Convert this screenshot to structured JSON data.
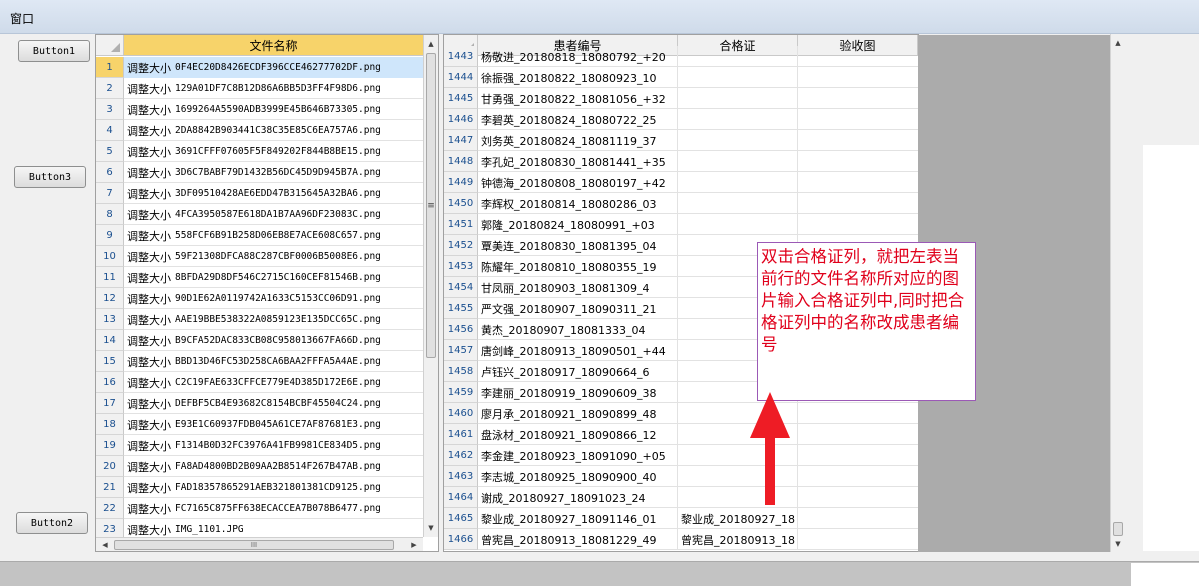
{
  "window": {
    "title": "窗口"
  },
  "buttons": {
    "button1": "Button1",
    "button3": "Button3",
    "button2": "Button2"
  },
  "left_grid": {
    "column": "文件名称",
    "rows": [
      {
        "n": "1",
        "text": "调整大小",
        "file": "0F4EC20D8426ECDF396CCE46277702DF.png"
      },
      {
        "n": "2",
        "text": "调整大小",
        "file": "129A01DF7C8B12D86A6BB5D3FF4F98D6.png"
      },
      {
        "n": "3",
        "text": "调整大小",
        "file": "1699264A5590ADB3999E45B646B73305.png"
      },
      {
        "n": "4",
        "text": "调整大小",
        "file": "2DA8842B903441C38C35E85C6EA757A6.png"
      },
      {
        "n": "5",
        "text": "调整大小",
        "file": "3691CFFF07605F5F849202F844B8BE15.png"
      },
      {
        "n": "6",
        "text": "调整大小",
        "file": "3D6C7BABF79D1432B56DC45D9D945B7A.png"
      },
      {
        "n": "7",
        "text": "调整大小",
        "file": "3DF09510428AE6EDD47B315645A32BA6.png"
      },
      {
        "n": "8",
        "text": "调整大小",
        "file": "4FCA3950587E618DA1B7AA96DF23083C.png"
      },
      {
        "n": "9",
        "text": "调整大小",
        "file": "558FCF6B91B258D06EB8E7ACE608C657.png"
      },
      {
        "n": "10",
        "text": "调整大小",
        "file": "59F21308DFCA88C287CBF0006B5008E6.png"
      },
      {
        "n": "11",
        "text": "调整大小",
        "file": "8BFDA29D8DF546C2715C160CEF81546B.png"
      },
      {
        "n": "12",
        "text": "调整大小",
        "file": "90D1E62A0119742A1633C5153CC06D91.png"
      },
      {
        "n": "13",
        "text": "调整大小",
        "file": "AAE19BBE538322A0859123E135DCC65C.png"
      },
      {
        "n": "14",
        "text": "调整大小",
        "file": "B9CFA52DAC833CB08C958013667FA66D.png"
      },
      {
        "n": "15",
        "text": "调整大小",
        "file": "BBD13D46FC53D258CA6BAA2FFFA5A4AE.png"
      },
      {
        "n": "16",
        "text": "调整大小",
        "file": "C2C19FAE633CFFCE779E4D385D172E6E.png"
      },
      {
        "n": "17",
        "text": "调整大小",
        "file": "DEFBF5CB4E93682C8154BCBF45504C24.png"
      },
      {
        "n": "18",
        "text": "调整大小",
        "file": "E93E1C60937FDB045A61CE7AF87681E3.png"
      },
      {
        "n": "19",
        "text": "调整大小",
        "file": "F1314B0D32FC3976A41FB9981CE834D5.png"
      },
      {
        "n": "20",
        "text": "调整大小",
        "file": "FA8AD4800BD2B09AA2B8514F267B47AB.png"
      },
      {
        "n": "21",
        "text": "调整大小",
        "file": "FAD18357865291AEB321801381CD9125.png"
      },
      {
        "n": "22",
        "text": "调整大小",
        "file": "FC7165C875FF638ECACCEA7B078B6477.png"
      },
      {
        "n": "23",
        "text": "调整大小",
        "file": "IMG_1101.JPG"
      }
    ],
    "hscroll_label": "III"
  },
  "right_grid": {
    "columns": [
      "患者编号",
      "合格证",
      "验收图"
    ],
    "rows": [
      {
        "n": "1443",
        "patient": "杨敬进_20180818_18080792_+20",
        "cert": ""
      },
      {
        "n": "1444",
        "patient": "徐振强_20180822_18080923_10",
        "cert": ""
      },
      {
        "n": "1445",
        "patient": "甘勇强_20180822_18081056_+32",
        "cert": ""
      },
      {
        "n": "1446",
        "patient": "李碧英_20180824_18080722_25",
        "cert": ""
      },
      {
        "n": "1447",
        "patient": "刘务英_20180824_18081119_37",
        "cert": ""
      },
      {
        "n": "1448",
        "patient": "李孔妃_20180830_18081441_+35",
        "cert": ""
      },
      {
        "n": "1449",
        "patient": "钟德海_20180808_18080197_+42",
        "cert": ""
      },
      {
        "n": "1450",
        "patient": "李辉权_20180814_18080286_03",
        "cert": ""
      },
      {
        "n": "1451",
        "patient": "郭隆_20180824_18080991_+03",
        "cert": ""
      },
      {
        "n": "1452",
        "patient": "覃美连_20180830_18081395_04",
        "cert": ""
      },
      {
        "n": "1453",
        "patient": "陈耀年_20180810_18080355_19",
        "cert": ""
      },
      {
        "n": "1454",
        "patient": "甘凤丽_20180903_18081309_4",
        "cert": ""
      },
      {
        "n": "1455",
        "patient": "严文强_20180907_18090311_21",
        "cert": ""
      },
      {
        "n": "1456",
        "patient": "黄杰_20180907_18081333_04",
        "cert": ""
      },
      {
        "n": "1457",
        "patient": "唐剑峰_20180913_18090501_+44",
        "cert": ""
      },
      {
        "n": "1458",
        "patient": "卢钰兴_20180917_18090664_6",
        "cert": ""
      },
      {
        "n": "1459",
        "patient": "李建丽_20180919_18090609_38",
        "cert": ""
      },
      {
        "n": "1460",
        "patient": "廖月承_20180921_18090899_48",
        "cert": ""
      },
      {
        "n": "1461",
        "patient": "盘泳材_20180921_18090866_12",
        "cert": ""
      },
      {
        "n": "1462",
        "patient": "李金建_20180923_18091090_+05",
        "cert": ""
      },
      {
        "n": "1463",
        "patient": "李志城_20180925_18090900_40",
        "cert": ""
      },
      {
        "n": "1464",
        "patient": "谢成_20180927_18091023_24",
        "cert": ""
      },
      {
        "n": "1465",
        "patient": "黎业成_20180927_18091146_01",
        "cert": "黎业成_20180927_18"
      },
      {
        "n": "1466",
        "patient": "曾宪昌_20180913_18081229_49",
        "cert": "曾宪昌_20180913_18"
      }
    ]
  },
  "annotation": {
    "text": "双击合格证列，就把左表当前行的文件名称所对应的图片输入合格证列中,同时把合格证列中的名称改成患者编号",
    "arrow_color": "#ee1c25"
  }
}
